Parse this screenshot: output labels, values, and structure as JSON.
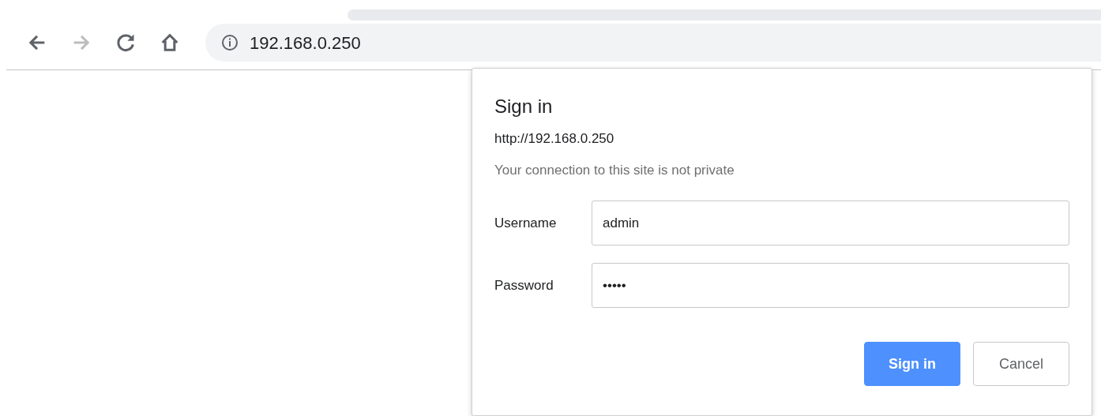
{
  "toolbar": {
    "buttons": [
      {
        "kind": "back",
        "disabled": false
      },
      {
        "kind": "forward",
        "disabled": true
      },
      {
        "kind": "reload",
        "disabled": false
      },
      {
        "kind": "home",
        "disabled": false
      }
    ],
    "address": "192.168.0.250"
  },
  "dialog": {
    "title": "Sign in",
    "origin": "http://192.168.0.250",
    "warning": "Your connection to this site is not private",
    "fields": [
      {
        "label": "Username",
        "value": "admin"
      },
      {
        "label": "Password",
        "value": "•••••"
      }
    ],
    "buttons": [
      {
        "label": "Sign in",
        "kind": "primary"
      },
      {
        "label": "Cancel",
        "kind": "secondary"
      }
    ]
  }
}
